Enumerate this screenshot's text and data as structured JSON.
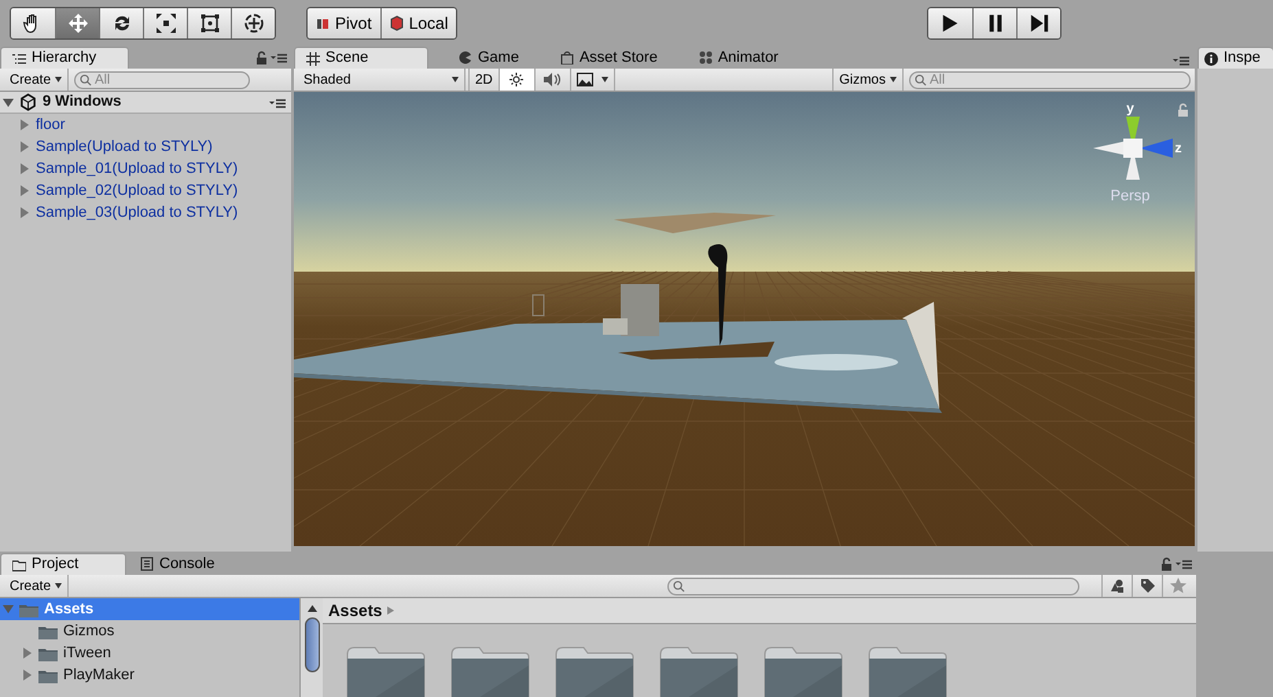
{
  "toolbar": {
    "tools": [
      {
        "kind": "hand",
        "selected": false
      },
      {
        "kind": "move",
        "selected": true
      },
      {
        "kind": "rotate",
        "selected": false
      },
      {
        "kind": "scale",
        "selected": false
      },
      {
        "kind": "rect",
        "selected": false
      },
      {
        "kind": "transform",
        "selected": false
      }
    ],
    "pivot_buttons": [
      {
        "label": "Pivot"
      },
      {
        "label": "Local"
      }
    ],
    "play_buttons": [
      {
        "kind": "play"
      },
      {
        "kind": "pause"
      },
      {
        "kind": "step"
      }
    ]
  },
  "hierarchy": {
    "tab": "Hierarchy",
    "create": "Create",
    "search": {
      "placeholder": "All"
    },
    "scene": {
      "label": "9 Windows",
      "expanded": true,
      "children": [
        {
          "label": "floor",
          "expanded": false
        },
        {
          "label": "Sample(Upload to STYLY)",
          "expanded": false
        },
        {
          "label": "Sample_01(Upload to STYLY)",
          "expanded": false
        },
        {
          "label": "Sample_02(Upload to STYLY)",
          "expanded": false
        },
        {
          "label": "Sample_03(Upload to STYLY)",
          "expanded": false
        }
      ]
    }
  },
  "scene_panel": {
    "tabs": [
      {
        "label": "Scene",
        "kind": "scene",
        "selected": true
      },
      {
        "label": "Game",
        "kind": "game",
        "selected": false
      },
      {
        "label": "Asset Store",
        "kind": "store",
        "selected": false
      },
      {
        "label": "Animator",
        "kind": "animator",
        "selected": false
      }
    ],
    "shading": "Shaded",
    "mode_2d": "2D",
    "lighting_on": true,
    "audio_on": false,
    "gizmos": "Gizmos",
    "search": {
      "placeholder": "All"
    },
    "gizmo_labels": {
      "y": "y",
      "z": "z",
      "projection": "Persp"
    }
  },
  "inspector": {
    "tab": "Inspe"
  },
  "project": {
    "tabs": [
      {
        "label": "Project",
        "kind": "project",
        "selected": true
      },
      {
        "label": "Console",
        "kind": "console",
        "selected": false
      }
    ],
    "create": "Create",
    "tree": [
      {
        "label": "Assets",
        "selected": true,
        "expanded": true,
        "children": [
          {
            "label": "Gizmos",
            "kind": "leaf",
            "selected": false
          },
          {
            "label": "iTween",
            "kind": "group",
            "selected": false,
            "expanded": false
          },
          {
            "label": "PlayMaker",
            "kind": "group",
            "selected": false,
            "expanded": false
          }
        ]
      }
    ],
    "breadcrumb": "Assets",
    "folders": [
      {
        "kind": "folder"
      },
      {
        "kind": "folder"
      },
      {
        "kind": "folder"
      },
      {
        "kind": "folder"
      },
      {
        "kind": "folder"
      },
      {
        "kind": "folder"
      }
    ]
  }
}
